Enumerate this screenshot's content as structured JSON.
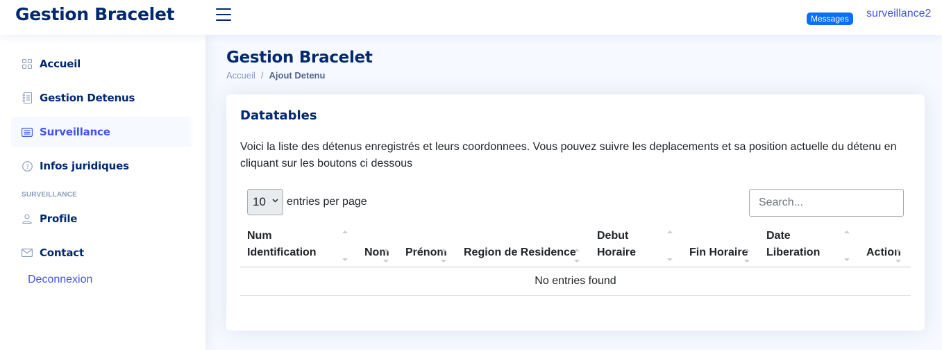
{
  "header": {
    "logo": "Gestion Bracelet",
    "messages_badge": "Messages",
    "user": "surveillance2"
  },
  "sidebar": {
    "items": [
      {
        "label": "Accueil",
        "icon": "grid-icon"
      },
      {
        "label": "Gestion Detenus",
        "icon": "journal-icon"
      },
      {
        "label": "Surveillance",
        "icon": "list-card-icon",
        "active": true
      },
      {
        "label": "Infos juridiques",
        "icon": "question-circle-icon"
      }
    ],
    "section_heading": "SURVEILLANCE",
    "section_items": [
      {
        "label": "Profile",
        "icon": "person-icon"
      },
      {
        "label": "Contact",
        "icon": "envelope-icon"
      }
    ],
    "logout": "Deconnexion"
  },
  "page": {
    "title": "Gestion Bracelet",
    "breadcrumb": {
      "home": "Accueil",
      "separator": "/",
      "current": "Ajout Detenu"
    }
  },
  "card": {
    "title": "Datatables",
    "description": "Voici la liste des détenus enregistrés et leurs coordonnees. Vous pouvez suivre les deplacements et sa position actuelle du détenu en cliquant sur les boutons ci dessous",
    "entries_value": "10",
    "entries_label": "entries per page",
    "search_placeholder": "Search...",
    "columns": [
      {
        "line1": "Num",
        "line2": "Identification"
      },
      {
        "line1": "",
        "line2": "Nom"
      },
      {
        "line1": "",
        "line2": "Prénom"
      },
      {
        "line1": "",
        "line2": "Region de Residence"
      },
      {
        "line1": "Debut",
        "line2": "Horaire"
      },
      {
        "line1": "",
        "line2": "Fin Horaire"
      },
      {
        "line1": "Date",
        "line2": "Liberation"
      },
      {
        "line1": "",
        "line2": "Action"
      }
    ],
    "empty_message": "No entries found"
  },
  "colors": {
    "navy": "#012970",
    "accent": "#4154f1",
    "badge": "#0d6efd",
    "page_bg": "#f6f9ff"
  }
}
